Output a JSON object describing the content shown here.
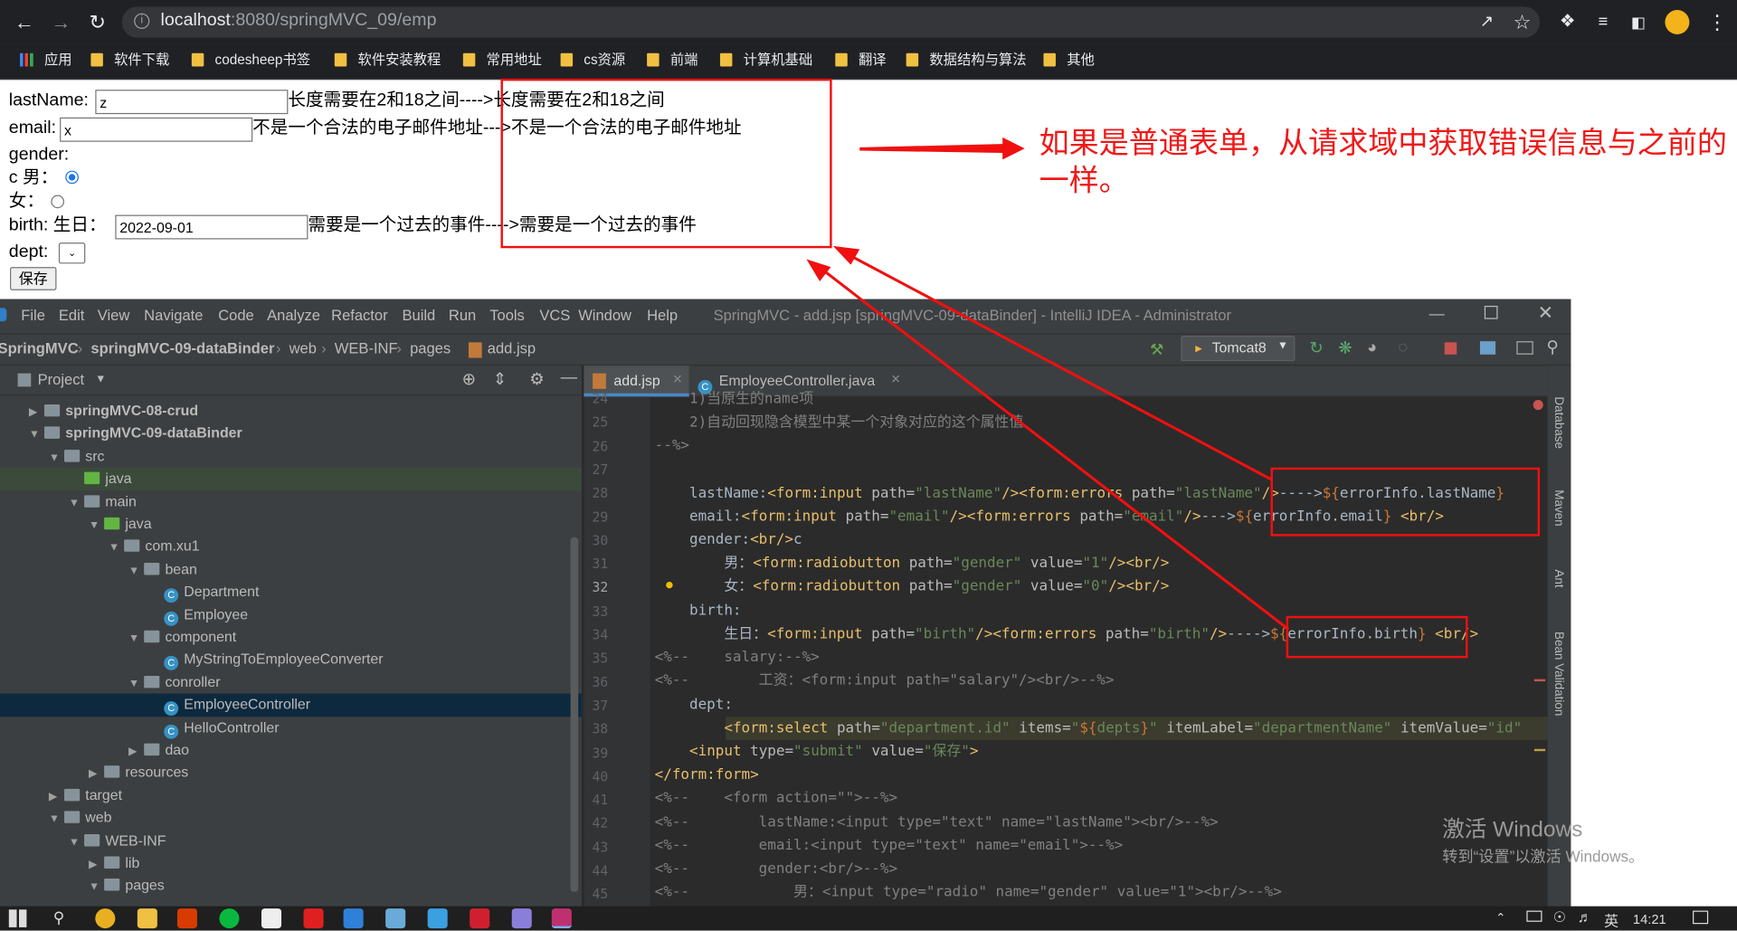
{
  "browser": {
    "url_host": "localhost",
    "url_path": ":8080/springMVC_09/emp",
    "bookmarks": [
      "应用",
      "软件下载",
      "codesheep书签",
      "软件安装教程",
      "常用地址",
      "cs资源",
      "前端",
      "计算机基础",
      "翻译",
      "数据结构与算法",
      "其他"
    ]
  },
  "form": {
    "lastname_label": "lastName:",
    "lastname_value": "z",
    "lastname_error": "长度需要在2和18之间---->长度需要在2和18之间",
    "email_label": "email:",
    "email_value": "x",
    "email_error": "不是一个合法的电子邮件地址--->不是一个合法的电子邮件地址",
    "gender_label": "gender:",
    "male_label": "c 男：",
    "female_label": "女：",
    "birth_label": "birth: 生日：",
    "birth_value": "2022-09-01",
    "birth_error": "需要是一个过去的事件---->需要是一个过去的事件",
    "dept_label": "dept:",
    "save_label": "保存"
  },
  "annotation": "如果是普通表单，从请求域中获取错误信息与之前的一样。",
  "ide": {
    "title": "SpringMVC - add.jsp [springMVC-09-dataBinder] - IntelliJ IDEA - Administrator",
    "menu": [
      "File",
      "Edit",
      "View",
      "Navigate",
      "Code",
      "Analyze",
      "Refactor",
      "Build",
      "Run",
      "Tools",
      "VCS",
      "Window",
      "Help"
    ],
    "breadcrumb": [
      "SpringMVC",
      "springMVC-09-dataBinder",
      "web",
      "WEB-INF",
      "pages",
      "add.jsp"
    ],
    "run_config": "Tomcat8",
    "project_label": "Project",
    "tree": [
      {
        "depth": 1,
        "label": "springMVC-08-crud",
        "kind": "module",
        "exp": false
      },
      {
        "depth": 1,
        "label": "springMVC-09-dataBinder",
        "kind": "module",
        "exp": true
      },
      {
        "depth": 2,
        "label": "src",
        "kind": "folder",
        "exp": true
      },
      {
        "depth": 3,
        "label": "java",
        "kind": "srcfolder",
        "exp": null
      },
      {
        "depth": 3,
        "label": "main",
        "kind": "folder",
        "exp": true
      },
      {
        "depth": 4,
        "label": "java",
        "kind": "srcfolder",
        "exp": true
      },
      {
        "depth": 5,
        "label": "com.xu1",
        "kind": "pkg",
        "exp": true
      },
      {
        "depth": 6,
        "label": "bean",
        "kind": "pkg",
        "exp": true
      },
      {
        "depth": 7,
        "label": "Department",
        "kind": "class",
        "exp": null
      },
      {
        "depth": 7,
        "label": "Employee",
        "kind": "class",
        "exp": null
      },
      {
        "depth": 6,
        "label": "component",
        "kind": "pkg",
        "exp": true
      },
      {
        "depth": 7,
        "label": "MyStringToEmployeeConverter",
        "kind": "class",
        "exp": null
      },
      {
        "depth": 6,
        "label": "conroller",
        "kind": "pkg",
        "exp": true
      },
      {
        "depth": 7,
        "label": "EmployeeController",
        "kind": "class",
        "exp": null,
        "selected": true
      },
      {
        "depth": 7,
        "label": "HelloController",
        "kind": "class",
        "exp": null
      },
      {
        "depth": 6,
        "label": "dao",
        "kind": "pkg",
        "exp": false
      },
      {
        "depth": 4,
        "label": "resources",
        "kind": "folder",
        "exp": false
      },
      {
        "depth": 2,
        "label": "target",
        "kind": "folder",
        "exp": false
      },
      {
        "depth": 2,
        "label": "web",
        "kind": "folder",
        "exp": true
      },
      {
        "depth": 3,
        "label": "WEB-INF",
        "kind": "folder",
        "exp": true
      },
      {
        "depth": 4,
        "label": "lib",
        "kind": "folder",
        "exp": false
      },
      {
        "depth": 4,
        "label": "pages",
        "kind": "folder",
        "exp": true
      }
    ],
    "tabs": [
      "add.jsp",
      "EmployeeController.java"
    ],
    "line_numbers": [
      "24",
      "25",
      "26",
      "27",
      "28",
      "29",
      "30",
      "31",
      "32",
      "33",
      "34",
      "35",
      "36",
      "37",
      "38",
      "39",
      "40",
      "41",
      "42",
      "43",
      "44",
      "45"
    ],
    "right_tabs": [
      "Database",
      "Maven",
      "Ant",
      "Bean Validation"
    ]
  },
  "watermark": {
    "line1": "激活 Windows",
    "line2": "转到“设置”以激活 Windows。"
  },
  "taskbar": {
    "ime": "英",
    "time": "14:21"
  }
}
